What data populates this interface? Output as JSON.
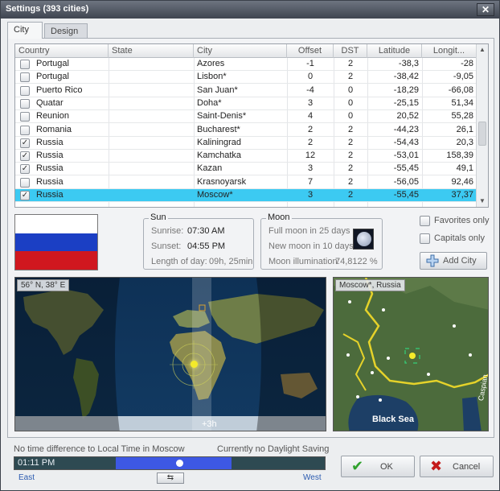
{
  "window": {
    "title": "Settings (393 cities)",
    "close_glyph": "✕"
  },
  "tabs": [
    {
      "label": "City",
      "active": true
    },
    {
      "label": "Design",
      "active": false
    }
  ],
  "table": {
    "headers": [
      "Country",
      "State",
      "City",
      "Offset",
      "DST",
      "Latitude",
      "Longit..."
    ],
    "rows": [
      {
        "checked": false,
        "selected": false,
        "country": "Portugal",
        "state": "",
        "city": "Azores",
        "offset": "-1",
        "dst": "2",
        "lat": "-38,3",
        "lon": "-28"
      },
      {
        "checked": false,
        "selected": false,
        "country": "Portugal",
        "state": "",
        "city": "Lisbon*",
        "offset": "0",
        "dst": "2",
        "lat": "-38,42",
        "lon": "-9,05"
      },
      {
        "checked": false,
        "selected": false,
        "country": "Puerto Rico",
        "state": "",
        "city": "San Juan*",
        "offset": "-4",
        "dst": "0",
        "lat": "-18,29",
        "lon": "-66,08"
      },
      {
        "checked": false,
        "selected": false,
        "country": "Quatar",
        "state": "",
        "city": "Doha*",
        "offset": "3",
        "dst": "0",
        "lat": "-25,15",
        "lon": "51,34"
      },
      {
        "checked": false,
        "selected": false,
        "country": "Reunion",
        "state": "",
        "city": "Saint-Denis*",
        "offset": "4",
        "dst": "0",
        "lat": "20,52",
        "lon": "55,28"
      },
      {
        "checked": false,
        "selected": false,
        "country": "Romania",
        "state": "",
        "city": "Bucharest*",
        "offset": "2",
        "dst": "2",
        "lat": "-44,23",
        "lon": "26,1"
      },
      {
        "checked": true,
        "selected": false,
        "country": "Russia",
        "state": "",
        "city": "Kaliningrad",
        "offset": "2",
        "dst": "2",
        "lat": "-54,43",
        "lon": "20,3"
      },
      {
        "checked": true,
        "selected": false,
        "country": "Russia",
        "state": "",
        "city": "Kamchatka",
        "offset": "12",
        "dst": "2",
        "lat": "-53,01",
        "lon": "158,39"
      },
      {
        "checked": true,
        "selected": false,
        "country": "Russia",
        "state": "",
        "city": "Kazan",
        "offset": "3",
        "dst": "2",
        "lat": "-55,45",
        "lon": "49,1"
      },
      {
        "checked": false,
        "selected": false,
        "country": "Russia",
        "state": "",
        "city": "Krasnoyarsk",
        "offset": "7",
        "dst": "2",
        "lat": "-56,05",
        "lon": "92,46"
      },
      {
        "checked": true,
        "selected": true,
        "country": "Russia",
        "state": "",
        "city": "Moscow*",
        "offset": "3",
        "dst": "2",
        "lat": "-55,45",
        "lon": "37,37"
      }
    ]
  },
  "flag_colors": [
    "#ffffff",
    "#1b3fc4",
    "#d0171f"
  ],
  "sun": {
    "title": "Sun",
    "sunrise_label": "Sunrise:",
    "sunrise": "07:30 AM",
    "sunset_label": "Sunset:",
    "sunset": "04:55 PM",
    "daylength_label": "Length of day:",
    "daylength": "09h, 25min"
  },
  "moon": {
    "title": "Moon",
    "full": "Full moon in 25 days",
    "new": "New moon in 10 days",
    "illum_label": "Moon illumination:",
    "illum": "74,8122 %"
  },
  "options": {
    "favorites": "Favorites only",
    "capitals": "Capitals only",
    "add_city": "Add City"
  },
  "worldmap": {
    "coords": "56° N, 38° E",
    "offset_label": "+3h"
  },
  "regionmap": {
    "label": "Moscow*, Russia",
    "sea": "Black Sea",
    "sea2": "Caspian"
  },
  "bottom": {
    "status_left": "No time difference to Local Time in Moscow",
    "status_right": "Currently no Daylight Saving",
    "time": "01:11 PM",
    "east": "East",
    "west": "West",
    "swap_glyph": "⇆",
    "day_fraction": 0.55
  },
  "buttons": {
    "ok": "OK",
    "cancel": "Cancel",
    "ok_glyph": "✔",
    "cancel_glyph": "✖"
  },
  "colors": {
    "selection": "#3ccaf2",
    "ok_green": "#2fa12c",
    "cancel_red": "#c41a1a"
  }
}
